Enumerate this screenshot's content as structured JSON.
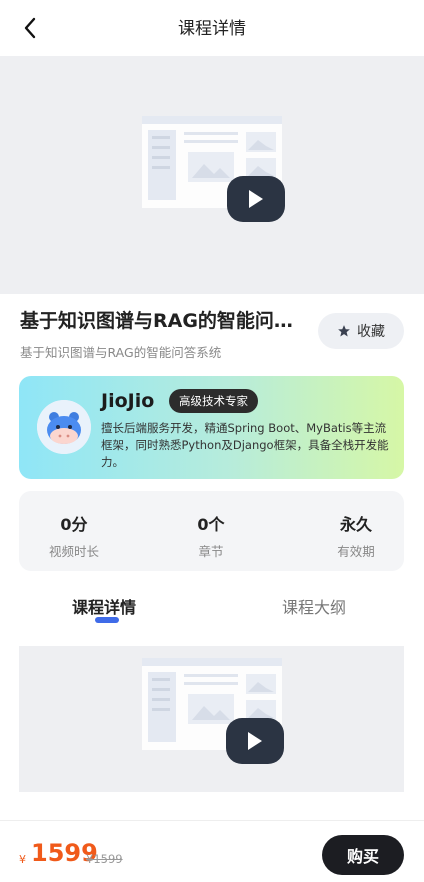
{
  "header": {
    "title": "课程详情",
    "back_icon": "chevron-left-icon"
  },
  "course": {
    "title": "基于知识图谱与RAG的智能问…",
    "subtitle": "基于知识图谱与RAG的智能问答系统",
    "favorite_label": "收藏",
    "favorite_icon": "star-icon"
  },
  "teacher": {
    "name": "JioJio",
    "badge": "高级技术专家",
    "description": "擅长后端服务开发，精通Spring Boot、MyBatis等主流框架，同时熟悉Python及Django框架，具备全栈开发能力。"
  },
  "stats": [
    {
      "value": "0分",
      "label": "视频时长"
    },
    {
      "value": "0个",
      "label": "章节"
    },
    {
      "value": "永久",
      "label": "有效期"
    }
  ],
  "tabs": [
    {
      "label": "课程详情",
      "active": true
    },
    {
      "label": "课程大纲",
      "active": false
    }
  ],
  "purchase": {
    "currency": "¥",
    "price": "1599",
    "original_price": "¥1599",
    "buy_label": "购买"
  },
  "colors": {
    "accent": "#3f6be8",
    "price": "#f05a1a",
    "dark": "#1c1d22"
  }
}
